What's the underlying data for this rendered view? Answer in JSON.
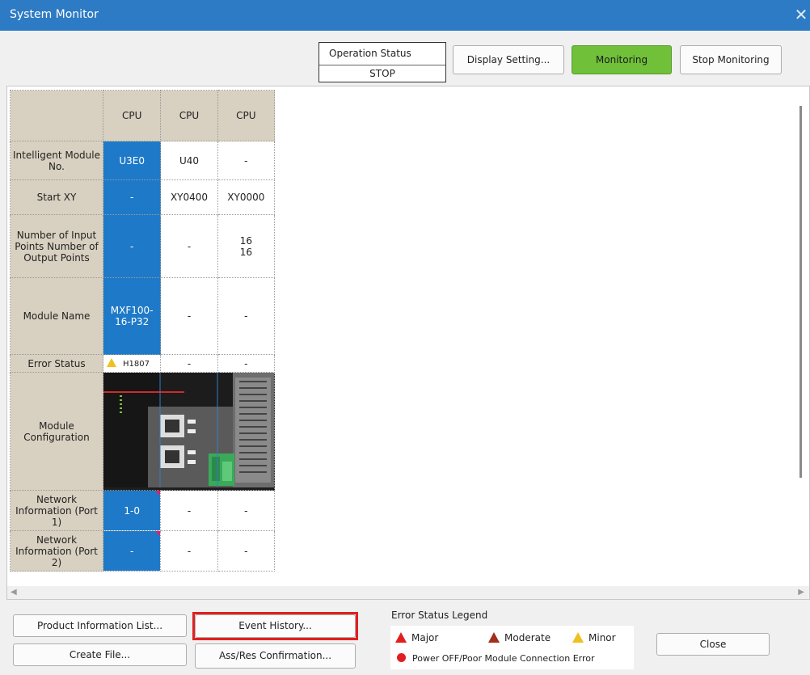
{
  "window": {
    "title": "System Monitor",
    "close_glyph": "✕"
  },
  "header": {
    "operation_status_label": "Operation Status",
    "operation_status_value": "STOP",
    "display_setting_label": "Display Setting...",
    "monitoring_label": "Monitoring",
    "stop_monitoring_label": "Stop Monitoring",
    "monitoring_color": "#70c03a"
  },
  "grid": {
    "columns": [
      "CPU",
      "CPU",
      "CPU"
    ],
    "row_labels": {
      "intelligent_module_no": "Intelligent Module No.",
      "start_xy": "Start XY",
      "points": "Number of Input Points Number of Output Points",
      "module_name": "Module Name",
      "error_status": "Error Status",
      "module_configuration": "Module Configuration",
      "network_port1": "Network Information (Port 1)",
      "network_port2": "Network Information (Port 2)"
    },
    "intelligent_module_no": [
      "U3E0",
      "U40",
      "-"
    ],
    "start_xy": [
      "-",
      "XY0400",
      "XY0000"
    ],
    "input_points": [
      "-",
      "-",
      "16"
    ],
    "output_points": [
      "",
      "",
      "16"
    ],
    "module_name": [
      "MXF100-16-P32",
      "-",
      "-"
    ],
    "error_status": [
      "H1807",
      "-",
      "-"
    ],
    "network_port1": [
      "1-0",
      "-",
      "-"
    ],
    "network_port2": [
      "-",
      "-",
      "-"
    ],
    "cpu_highlight_color": "#1e7ac8"
  },
  "bottom": {
    "product_info_label": "Product Information List...",
    "event_history_label": "Event History...",
    "create_file_label": "Create File...",
    "ass_res_label": "Ass/Res Confirmation...",
    "close_label": "Close",
    "legend_title": "Error Status Legend",
    "legend_major": "Major",
    "legend_moderate": "Moderate",
    "legend_minor": "Minor",
    "legend_power": "Power OFF/Poor Module Connection Error"
  }
}
